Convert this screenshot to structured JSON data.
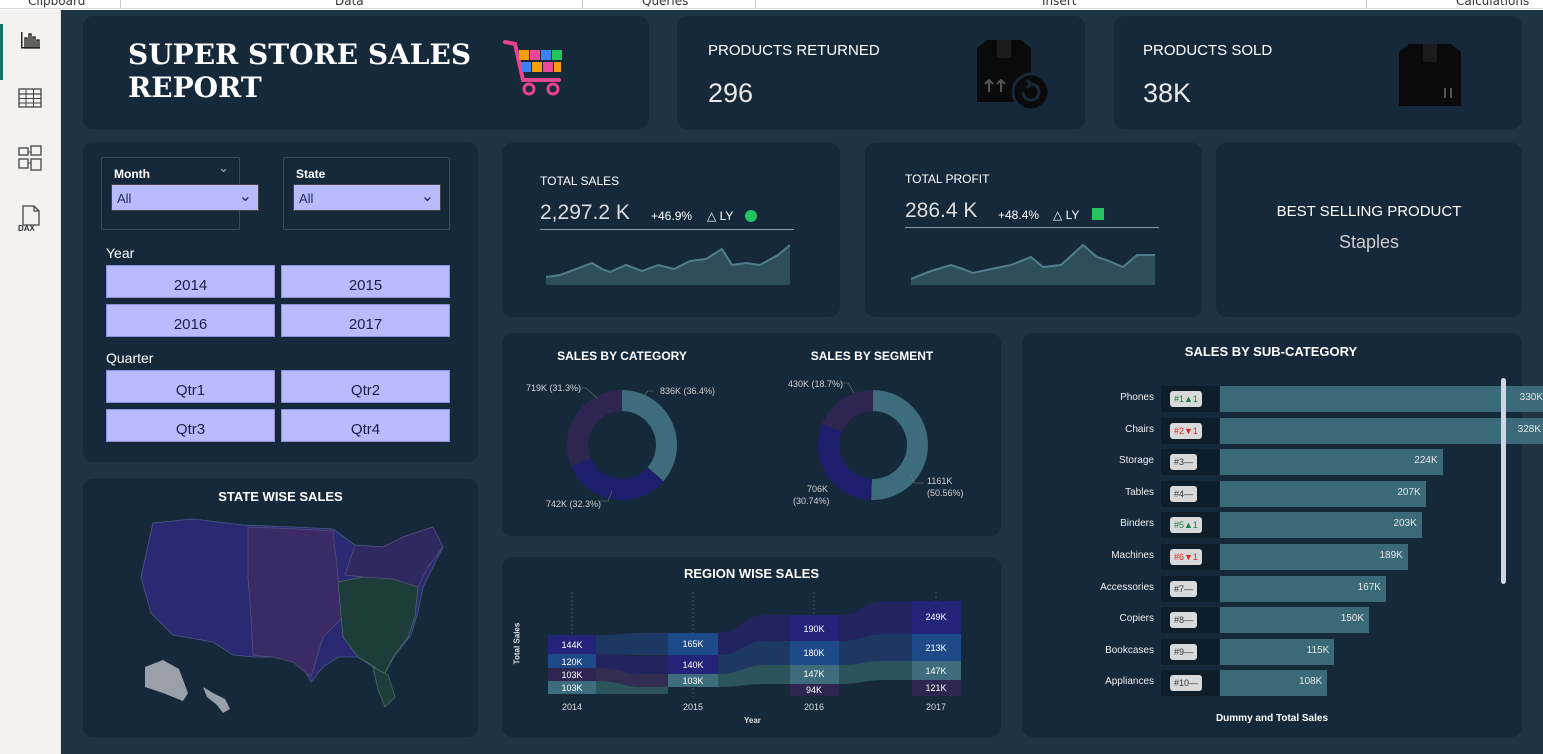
{
  "ribbon": {
    "groups": [
      "Clipboard",
      "Data",
      "Queries",
      "Insert",
      "Calculations"
    ]
  },
  "sidebar": {
    "items": [
      {
        "name": "report-view-icon",
        "active": true
      },
      {
        "name": "table-view-icon",
        "active": false
      },
      {
        "name": "model-view-icon",
        "active": false
      },
      {
        "name": "dax-query-view-icon",
        "active": false
      }
    ],
    "dax_label": "DAX"
  },
  "header": {
    "title_line1": "SUPER STORE SALES",
    "title_line2": "REPORT",
    "cart_icon": "shopping-cart-icon"
  },
  "kpi_returned": {
    "label": "PRODUCTS RETURNED",
    "value": "296",
    "icon": "box-return-icon"
  },
  "kpi_sold": {
    "label": "PRODUCTS SOLD",
    "value": "38K",
    "icon": "box-icon"
  },
  "filters": {
    "month": {
      "label": "Month",
      "value": "All"
    },
    "state": {
      "label": "State",
      "value": "All"
    },
    "year_label": "Year",
    "years": [
      "2014",
      "2015",
      "2016",
      "2017"
    ],
    "quarter_label": "Quarter",
    "quarters": [
      "Qtr1",
      "Qtr2",
      "Qtr3",
      "Qtr4"
    ]
  },
  "total_sales": {
    "label": "TOTAL SALES",
    "value": "2,297.2 K",
    "change": "+46.9%",
    "ly": "△ LY",
    "indicator_color": "#22c55e",
    "indicator_shape": "circle"
  },
  "total_profit": {
    "label": "TOTAL PROFIT",
    "value": "286.4 K",
    "change": "+48.4%",
    "ly": "△ LY",
    "indicator_color": "#22c55e",
    "indicator_shape": "square"
  },
  "best_selling": {
    "label": "BEST SELLING PRODUCT",
    "value": "Staples"
  },
  "sales_by_category": {
    "title": "SALES BY CATEGORY",
    "slices": [
      {
        "label": "836K (36.4%)",
        "value": 836,
        "color": "#3d6d7c"
      },
      {
        "label": "742K (32.3%)",
        "value": 742,
        "color": "#1e1e6e"
      },
      {
        "label": "719K (31.3%)",
        "value": 719,
        "color": "#2e2650"
      }
    ]
  },
  "sales_by_segment": {
    "title": "SALES BY SEGMENT",
    "slices": [
      {
        "label_line1": "1161K",
        "label_line2": "(50.56%)",
        "value": 1161,
        "color": "#3d6d7c"
      },
      {
        "label_line1": "706K",
        "label_line2": "(30.74%)",
        "value": 706,
        "color": "#1e1e6e"
      },
      {
        "label_line1": "430K (18.7%)",
        "label_line2": "",
        "value": 430,
        "color": "#2e2650"
      }
    ]
  },
  "state_map": {
    "title": "STATE WISE SALES"
  },
  "region_wise": {
    "title": "REGION WISE SALES",
    "ylabel": "Total Sales",
    "xlabel": "Year",
    "years": [
      "2014",
      "2015",
      "2016",
      "2017"
    ],
    "columns": [
      [
        "144K",
        "120K",
        "103K",
        "103K"
      ],
      [
        "165K",
        "140K",
        "103K"
      ],
      [
        "190K",
        "180K",
        "147K",
        "94K"
      ],
      [
        "249K",
        "213K",
        "147K",
        "121K"
      ]
    ]
  },
  "sub_category": {
    "title": "SALES BY SUB-CATEGORY",
    "xlabel": "Dummy and Total Sales",
    "rows": [
      {
        "name": "Phones",
        "rank": "#1",
        "trend": "▲1",
        "dir": "up",
        "value": 330,
        "label": "330K"
      },
      {
        "name": "Chairs",
        "rank": "#2",
        "trend": "▼1",
        "dir": "down",
        "value": 328,
        "label": "328K"
      },
      {
        "name": "Storage",
        "rank": "#3",
        "trend": "—",
        "dir": "flat",
        "value": 224,
        "label": "224K"
      },
      {
        "name": "Tables",
        "rank": "#4",
        "trend": "—",
        "dir": "flat",
        "value": 207,
        "label": "207K"
      },
      {
        "name": "Binders",
        "rank": "#5",
        "trend": "▲1",
        "dir": "up",
        "value": 203,
        "label": "203K"
      },
      {
        "name": "Machines",
        "rank": "#6",
        "trend": "▼1",
        "dir": "down",
        "value": 189,
        "label": "189K"
      },
      {
        "name": "Accessories",
        "rank": "#7",
        "trend": "—",
        "dir": "flat",
        "value": 167,
        "label": "167K"
      },
      {
        "name": "Copiers",
        "rank": "#8",
        "trend": "—",
        "dir": "flat",
        "value": 150,
        "label": "150K"
      },
      {
        "name": "Bookcases",
        "rank": "#9",
        "trend": "—",
        "dir": "flat",
        "value": 115,
        "label": "115K"
      },
      {
        "name": "Appliances",
        "rank": "#10",
        "trend": "—",
        "dir": "flat",
        "value": 108,
        "label": "108K"
      }
    ]
  },
  "chart_data": [
    {
      "type": "bar",
      "title": "SALES BY SUB-CATEGORY",
      "xlabel": "Dummy and Total Sales",
      "categories": [
        "Phones",
        "Chairs",
        "Storage",
        "Tables",
        "Binders",
        "Machines",
        "Accessories",
        "Copiers",
        "Bookcases",
        "Appliances"
      ],
      "values": [
        330,
        328,
        224,
        207,
        203,
        189,
        167,
        150,
        115,
        108
      ]
    },
    {
      "type": "pie",
      "title": "SALES BY CATEGORY",
      "categories": [
        "",
        "",
        ""
      ],
      "values": [
        836,
        742,
        719
      ]
    },
    {
      "type": "pie",
      "title": "SALES BY SEGMENT",
      "categories": [
        "",
        "",
        ""
      ],
      "values": [
        1161,
        706,
        430
      ]
    }
  ]
}
